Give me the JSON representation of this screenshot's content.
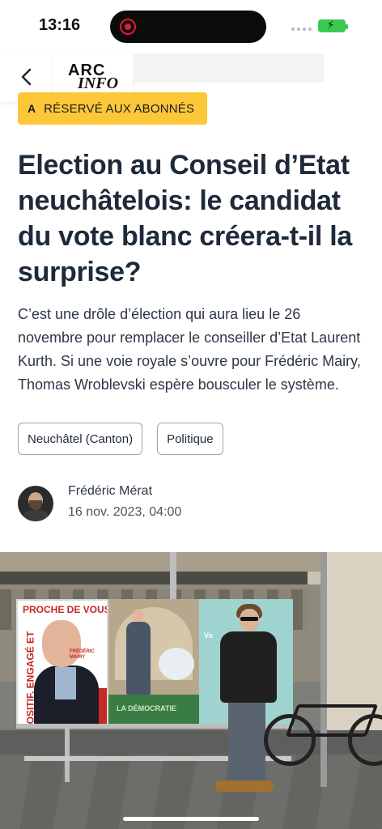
{
  "status_bar": {
    "time": "13:16"
  },
  "header": {
    "logo_top": "ARC",
    "logo_bottom": "INFO"
  },
  "badge": {
    "icon": "A",
    "label": "RÉSERVÉ AUX ABONNÉS",
    "color": "#fcc83a"
  },
  "article": {
    "title": "Election au Conseil d’Etat neuchâtelois: le candidat du vote blanc créera-t-il la surprise?",
    "lead": "C’est une drôle d’élection qui aura lieu le 26 novembre pour remplacer le conseiller d’Etat Laurent Kurth. Si une voie royale s’ouvre pour Frédéric Mairy, Thomas Wroblevski espère bousculer le système.",
    "tags": [
      "Neuchâtel (Canton)",
      "Politique"
    ],
    "author": {
      "name": "Frédéric Mérat",
      "date": "16 nov. 2023, 04:00"
    }
  },
  "hero_image": {
    "poster1_headline": "PROCHE DE VOUS",
    "poster1_vertical": "POSITIF, ENGAGÉ ET",
    "poster1_name": "FRÉDÉRIC MAIRY",
    "poster2_text": "LA DÉMOCRATIE",
    "poster3_text": "Vo"
  }
}
